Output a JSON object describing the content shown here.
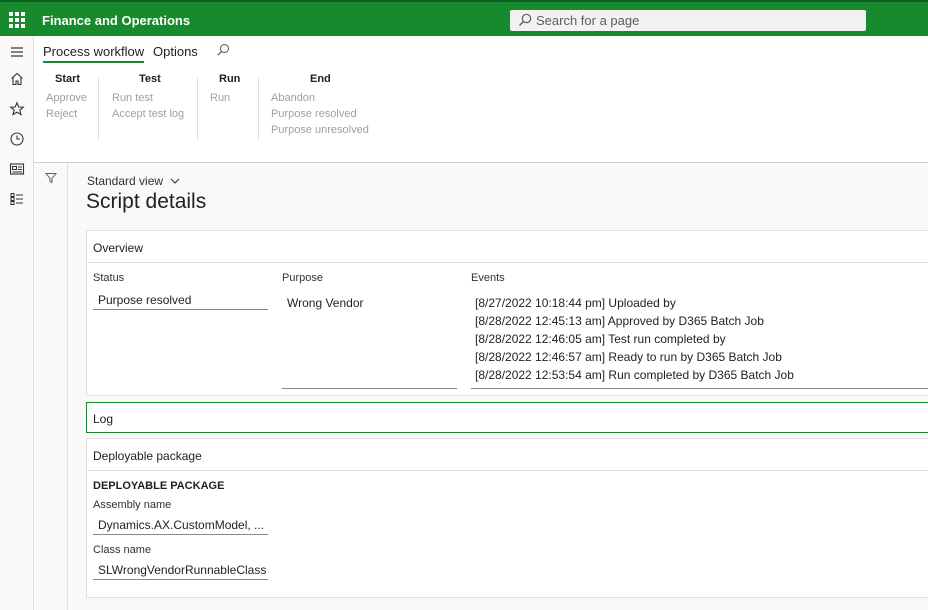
{
  "app": {
    "title": "Finance and Operations",
    "search_placeholder": "Search for a page"
  },
  "colors": {
    "brand": "#168a2c",
    "disabled_text": "#a19f9d"
  },
  "nav": {
    "icons": [
      "hamburger-icon",
      "home-icon",
      "star-icon",
      "clock-icon",
      "workspace-icon",
      "list-icon"
    ]
  },
  "action_pane": {
    "tabs": [
      {
        "label": "Process workflow",
        "active": true
      },
      {
        "label": "Options",
        "active": false
      }
    ],
    "groups": [
      {
        "title": "Start",
        "items": [
          "Approve",
          "Reject"
        ]
      },
      {
        "title": "Test",
        "items": [
          "Run test",
          "Accept test log"
        ]
      },
      {
        "title": "Run",
        "items": [
          "Run"
        ]
      },
      {
        "title": "End",
        "items": [
          "Abandon",
          "Purpose resolved",
          "Purpose unresolved"
        ]
      }
    ]
  },
  "page": {
    "view": "Standard view",
    "title": "Script details"
  },
  "overview": {
    "header": "Overview",
    "status_label": "Status",
    "status_value": "Purpose resolved",
    "purpose_label": "Purpose",
    "purpose_value": "Wrong Vendor",
    "events_label": "Events",
    "events": [
      "[8/27/2022 10:18:44 pm] Uploaded by",
      "[8/28/2022 12:45:13 am] Approved by D365 Batch Job",
      "[8/28/2022 12:46:05 am] Test run completed by",
      "[8/28/2022 12:46:57 am] Ready to run by D365 Batch Job",
      "[8/28/2022 12:53:54 am] Run completed by D365 Batch Job"
    ]
  },
  "log": {
    "header": "Log"
  },
  "deployable": {
    "header": "Deployable package",
    "section_title": "DEPLOYABLE PACKAGE",
    "assembly_label": "Assembly name",
    "assembly_value": "Dynamics.AX.CustomModel, ...",
    "class_label": "Class name",
    "class_value": "SLWrongVendorRunnableClass"
  }
}
